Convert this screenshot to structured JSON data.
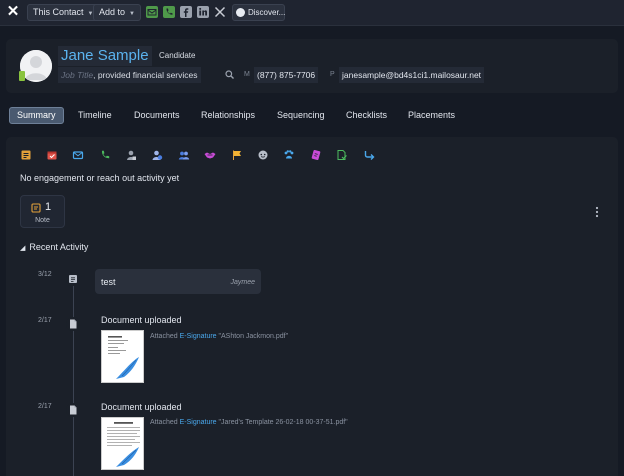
{
  "toolbar": {
    "contact_dropdown": "This Contact",
    "add_dropdown": "Add to",
    "discover_label": "Discover...",
    "icons": [
      "email-icon",
      "phone-icon",
      "facebook-icon",
      "linkedin-icon",
      "x-icon"
    ]
  },
  "contact": {
    "name": "Jane Sample",
    "type": "Candidate",
    "job_title_placeholder": "Job Title",
    "separator": ",",
    "company": "provided financial services",
    "mobile_label": "M",
    "phone": "(877) 875-7706",
    "personal_email_label": "P",
    "email": "janesample@bd4s1ci1.mailosaur.net"
  },
  "tabs": [
    {
      "label": "Summary",
      "active": true
    },
    {
      "label": "Timeline"
    },
    {
      "label": "Documents"
    },
    {
      "label": "Relationships"
    },
    {
      "label": "Sequencing"
    },
    {
      "label": "Checklists"
    },
    {
      "label": "Placements"
    }
  ],
  "activity_icons": [
    "note-icon",
    "calendar-task-icon",
    "email-icon",
    "call-icon",
    "person-icon",
    "add-person-icon",
    "group-icon",
    "handshake-icon",
    "flag-icon",
    "chat-icon",
    "paw-icon",
    "tag-icon",
    "document-check-icon",
    "arrow-turn-icon"
  ],
  "colors": {
    "accent": "#5bb3ef",
    "active_tab": "#4a5a70",
    "background": "#151a24",
    "panel": "#1b2029"
  },
  "summary": {
    "empty_message": "No engagement or reach out activity yet",
    "note_count": "1",
    "note_label": "Note",
    "recent_heading": "Recent Activity"
  },
  "timeline": [
    {
      "date": "3/12",
      "type": "note",
      "body": "test",
      "author": "Jaymee"
    },
    {
      "date": "2/17",
      "type": "document",
      "title": "Document uploaded",
      "attached_prefix": "Attached",
      "signature_label": "E-Signature",
      "file": "\"AShton Jackmon.pdf\""
    },
    {
      "date": "2/17",
      "type": "document",
      "title": "Document uploaded",
      "attached_prefix": "Attached",
      "signature_label": "E-Signature",
      "file": "\"Jared's Template 26-02-18 00-37-51.pdf\""
    }
  ]
}
